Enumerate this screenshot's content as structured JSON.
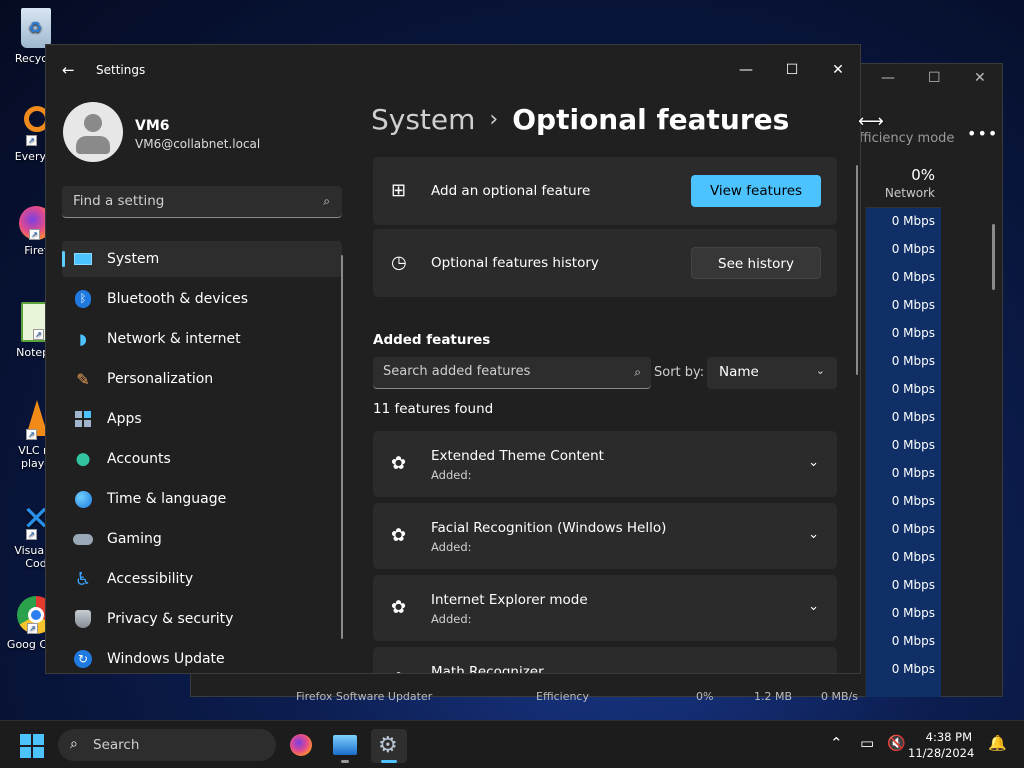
{
  "desktop": {
    "icons": [
      {
        "label": "Recycle",
        "icon": "recycle-bin-icon"
      },
      {
        "label": "Everyth",
        "icon": "everything-search-icon"
      },
      {
        "label": "Firef",
        "icon": "firefox-icon"
      },
      {
        "label": "Notepa",
        "icon": "notepad-icon"
      },
      {
        "label": "VLC m playe",
        "icon": "vlc-icon"
      },
      {
        "label": "Visual S Cod",
        "icon": "vscode-icon"
      },
      {
        "label": "Goog Chro",
        "icon": "chrome-icon"
      }
    ]
  },
  "task_manager": {
    "efficiency_label": "fficiency mode",
    "network_percent": "0%",
    "network_label": "Network",
    "network_values": [
      "0 Mbps",
      "0 Mbps",
      "0 Mbps",
      "0 Mbps",
      "0 Mbps",
      "0 Mbps",
      "0 Mbps",
      "0 Mbps",
      "0 Mbps",
      "0 Mbps",
      "0 Mbps",
      "0 Mbps",
      "0 Mbps",
      "0 Mbps",
      "0 Mbps",
      "0 Mbps",
      "0 Mbps"
    ],
    "bottom_row": {
      "name": "Firefox Software Updater",
      "status": "Efficiency",
      "cpu": "0%",
      "memory": "1.2 MB",
      "disk": "0 MB/s"
    }
  },
  "settings": {
    "window_title": "Settings",
    "profile": {
      "name": "VM6",
      "email": "VM6@collabnet.local"
    },
    "search_placeholder": "Find a setting",
    "nav": [
      {
        "label": "System",
        "icon": "monitor-icon",
        "active": true
      },
      {
        "label": "Bluetooth & devices",
        "icon": "bluetooth-icon"
      },
      {
        "label": "Network & internet",
        "icon": "wifi-icon"
      },
      {
        "label": "Personalization",
        "icon": "brush-icon"
      },
      {
        "label": "Apps",
        "icon": "apps-icon"
      },
      {
        "label": "Accounts",
        "icon": "person-icon"
      },
      {
        "label": "Time & language",
        "icon": "globe-clock-icon"
      },
      {
        "label": "Gaming",
        "icon": "gamepad-icon"
      },
      {
        "label": "Accessibility",
        "icon": "accessibility-icon"
      },
      {
        "label": "Privacy & security",
        "icon": "shield-icon"
      },
      {
        "label": "Windows Update",
        "icon": "update-icon"
      }
    ],
    "breadcrumb": {
      "parent": "System",
      "separator": "›",
      "current": "Optional features"
    },
    "add_card": {
      "label": "Add an optional feature",
      "button": "View features"
    },
    "history_card": {
      "label": "Optional features history",
      "button": "See history"
    },
    "added_heading": "Added features",
    "added_search_placeholder": "Search added features",
    "sort_label": "Sort by:",
    "sort_value": "Name",
    "count_text": "11 features found",
    "features": [
      {
        "name": "Extended Theme Content",
        "status": "Added:"
      },
      {
        "name": "Facial Recognition (Windows Hello)",
        "status": "Added:"
      },
      {
        "name": "Internet Explorer mode",
        "status": "Added:"
      },
      {
        "name": "Math Recognizer",
        "status": ""
      }
    ]
  },
  "taskbar": {
    "search_label": "Search",
    "time": "4:38 PM",
    "date": "11/28/2024"
  },
  "colors": {
    "accent": "#4cc2ff",
    "window_bg": "#202020",
    "card_bg": "#2b2b2b"
  }
}
